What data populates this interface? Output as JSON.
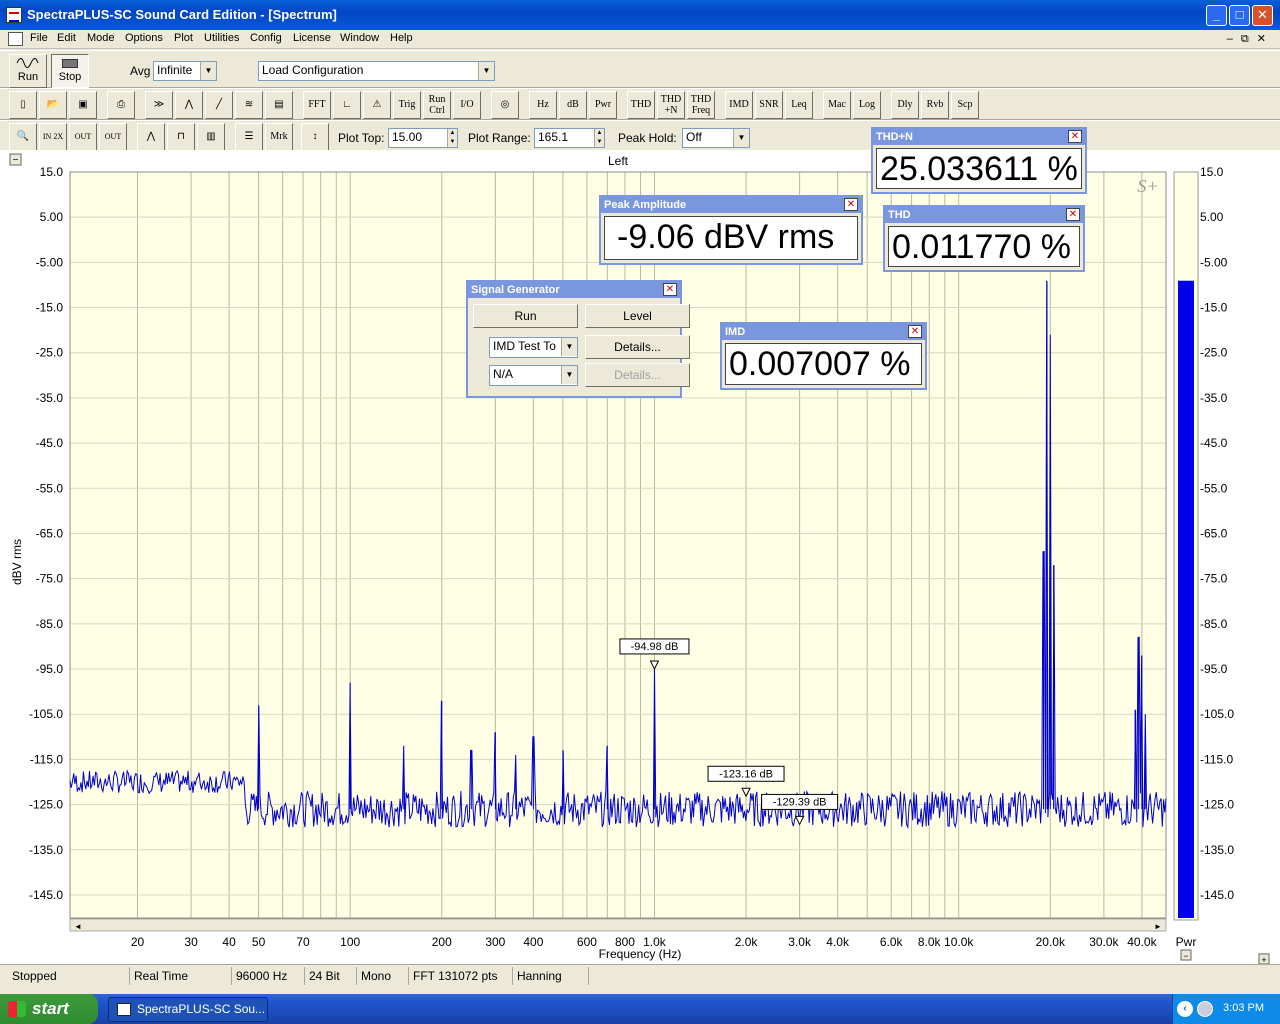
{
  "window": {
    "title": "SpectraPLUS-SC Sound Card Edition - [Spectrum]"
  },
  "menu": [
    "File",
    "Edit",
    "Mode",
    "Options",
    "Plot",
    "Utilities",
    "Config",
    "License",
    "Window",
    "Help"
  ],
  "toolbar": {
    "run_label": "Run",
    "stop_label": "Stop",
    "avg_label": "Avg",
    "avg_value": "Infinite",
    "config_value": "Load Configuration",
    "buttons_row2": [
      "FFT",
      "Trig",
      "Run Ctrl",
      "I/O",
      "Hz",
      "dB",
      "Pwr",
      "THD",
      "THD +N",
      "THD Freq",
      "IMD",
      "SNR",
      "Leq",
      "Mac",
      "Log",
      "Dly",
      "Rvb",
      "Scp"
    ],
    "mrk_label": "Mrk",
    "plot_top_label": "Plot Top:",
    "plot_top_value": "15.00",
    "plot_range_label": "Plot Range:",
    "plot_range_value": "165.1",
    "peak_hold_label": "Peak Hold:",
    "peak_hold_value": "Off"
  },
  "panels": {
    "thdn": {
      "title": "THD+N",
      "value": "25.033611 %"
    },
    "thd": {
      "title": "THD",
      "value": "0.011770 %"
    },
    "peak": {
      "title": "Peak Amplitude",
      "value": "-9.06 dBV rms"
    },
    "imd": {
      "title": "IMD",
      "value": "0.007007 %"
    },
    "siggen": {
      "title": "Signal Generator",
      "run": "Run",
      "level": "Level",
      "type_value": "IMD Test To",
      "details": "Details...",
      "second_value": "N/A",
      "details2": "Details..."
    }
  },
  "chart_data": {
    "type": "line",
    "title": "Left",
    "xlabel": "Frequency (Hz)",
    "ylabel": "dBV rms",
    "xscale": "log",
    "xlim": [
      12,
      48000
    ],
    "ylim": [
      -150.1,
      15.0
    ],
    "y_ticks": [
      "15.0",
      "5.00",
      "-5.00",
      "-15.0",
      "-25.0",
      "-35.0",
      "-45.0",
      "-55.0",
      "-65.0",
      "-75.0",
      "-85.0",
      "-95.0",
      "-105.0",
      "-115.0",
      "-125.0",
      "-135.0",
      "-145.0"
    ],
    "x_ticks": [
      {
        "v": 20,
        "t": "20"
      },
      {
        "v": 30,
        "t": "30"
      },
      {
        "v": 40,
        "t": "40"
      },
      {
        "v": 50,
        "t": "50"
      },
      {
        "v": 70,
        "t": "70"
      },
      {
        "v": 100,
        "t": "100"
      },
      {
        "v": 200,
        "t": "200"
      },
      {
        "v": 300,
        "t": "300"
      },
      {
        "v": 400,
        "t": "400"
      },
      {
        "v": 600,
        "t": "600"
      },
      {
        "v": 800,
        "t": "800"
      },
      {
        "v": 1000,
        "t": "1.0k"
      },
      {
        "v": 2000,
        "t": "2.0k"
      },
      {
        "v": 3000,
        "t": "3.0k"
      },
      {
        "v": 4000,
        "t": "4.0k"
      },
      {
        "v": 6000,
        "t": "6.0k"
      },
      {
        "v": 8000,
        "t": "8.0k"
      },
      {
        "v": 10000,
        "t": "10.0k"
      },
      {
        "v": 20000,
        "t": "20.0k"
      },
      {
        "v": 30000,
        "t": "30.0k"
      },
      {
        "v": 40000,
        "t": "40.0k"
      }
    ],
    "series": [
      {
        "color": "#0000cc",
        "noise_floor": -126,
        "peaks": [
          {
            "x": 50,
            "y": -103
          },
          {
            "x": 100,
            "y": -98
          },
          {
            "x": 150,
            "y": -112
          },
          {
            "x": 200,
            "y": -102
          },
          {
            "x": 250,
            "y": -113
          },
          {
            "x": 300,
            "y": -109
          },
          {
            "x": 350,
            "y": -114
          },
          {
            "x": 400,
            "y": -110
          },
          {
            "x": 500,
            "y": -113
          },
          {
            "x": 700,
            "y": -112
          },
          {
            "x": 1000,
            "y": -94.98
          },
          {
            "x": 19000,
            "y": -69
          },
          {
            "x": 19500,
            "y": -9.06
          },
          {
            "x": 20000,
            "y": -21
          },
          {
            "x": 20500,
            "y": -72
          },
          {
            "x": 38000,
            "y": -104
          },
          {
            "x": 39000,
            "y": -88
          },
          {
            "x": 40000,
            "y": -92
          },
          {
            "x": 41000,
            "y": -105
          }
        ]
      }
    ],
    "markers": [
      {
        "x": 1000,
        "y": -94.98,
        "label": "-94.98 dB"
      },
      {
        "x": 2000,
        "y": -123.16,
        "label": "-123.16 dB"
      },
      {
        "x": 3000,
        "y": -129.39,
        "label": "-129.39 dB"
      }
    ],
    "right_axis_label": "Pwr",
    "power_bar_level": -9.06,
    "watermark": "S+"
  },
  "status": [
    "Stopped",
    "Real Time",
    "96000 Hz",
    "24 Bit",
    "Mono",
    "FFT 131072 pts",
    "Hanning"
  ],
  "taskbar": {
    "start": "start",
    "task": "SpectraPLUS-SC Sou...",
    "clock": "3:03 PM"
  }
}
